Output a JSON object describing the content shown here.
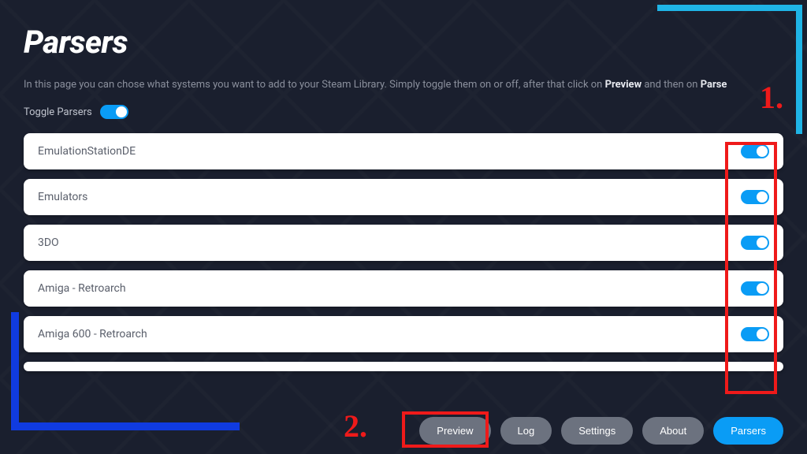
{
  "page": {
    "title": "Parsers",
    "description_pre": "In this page you can chose what systems you want to add to your Steam Library. Simply toggle them on or off, after that click on ",
    "description_bold1": "Preview",
    "description_mid": " and then on ",
    "description_bold2": "Parse"
  },
  "toggle_all": {
    "label": "Toggle Parsers",
    "state": "on"
  },
  "parsers": [
    {
      "name": "EmulationStationDE",
      "enabled": true
    },
    {
      "name": "Emulators",
      "enabled": true
    },
    {
      "name": "3DO",
      "enabled": true
    },
    {
      "name": "Amiga - Retroarch",
      "enabled": true
    },
    {
      "name": "Amiga 600 - Retroarch",
      "enabled": true
    }
  ],
  "nav": {
    "preview": "Preview",
    "log": "Log",
    "settings": "Settings",
    "about": "About",
    "parsers": "Parsers"
  },
  "annotations": {
    "one": "1.",
    "two": "2."
  }
}
